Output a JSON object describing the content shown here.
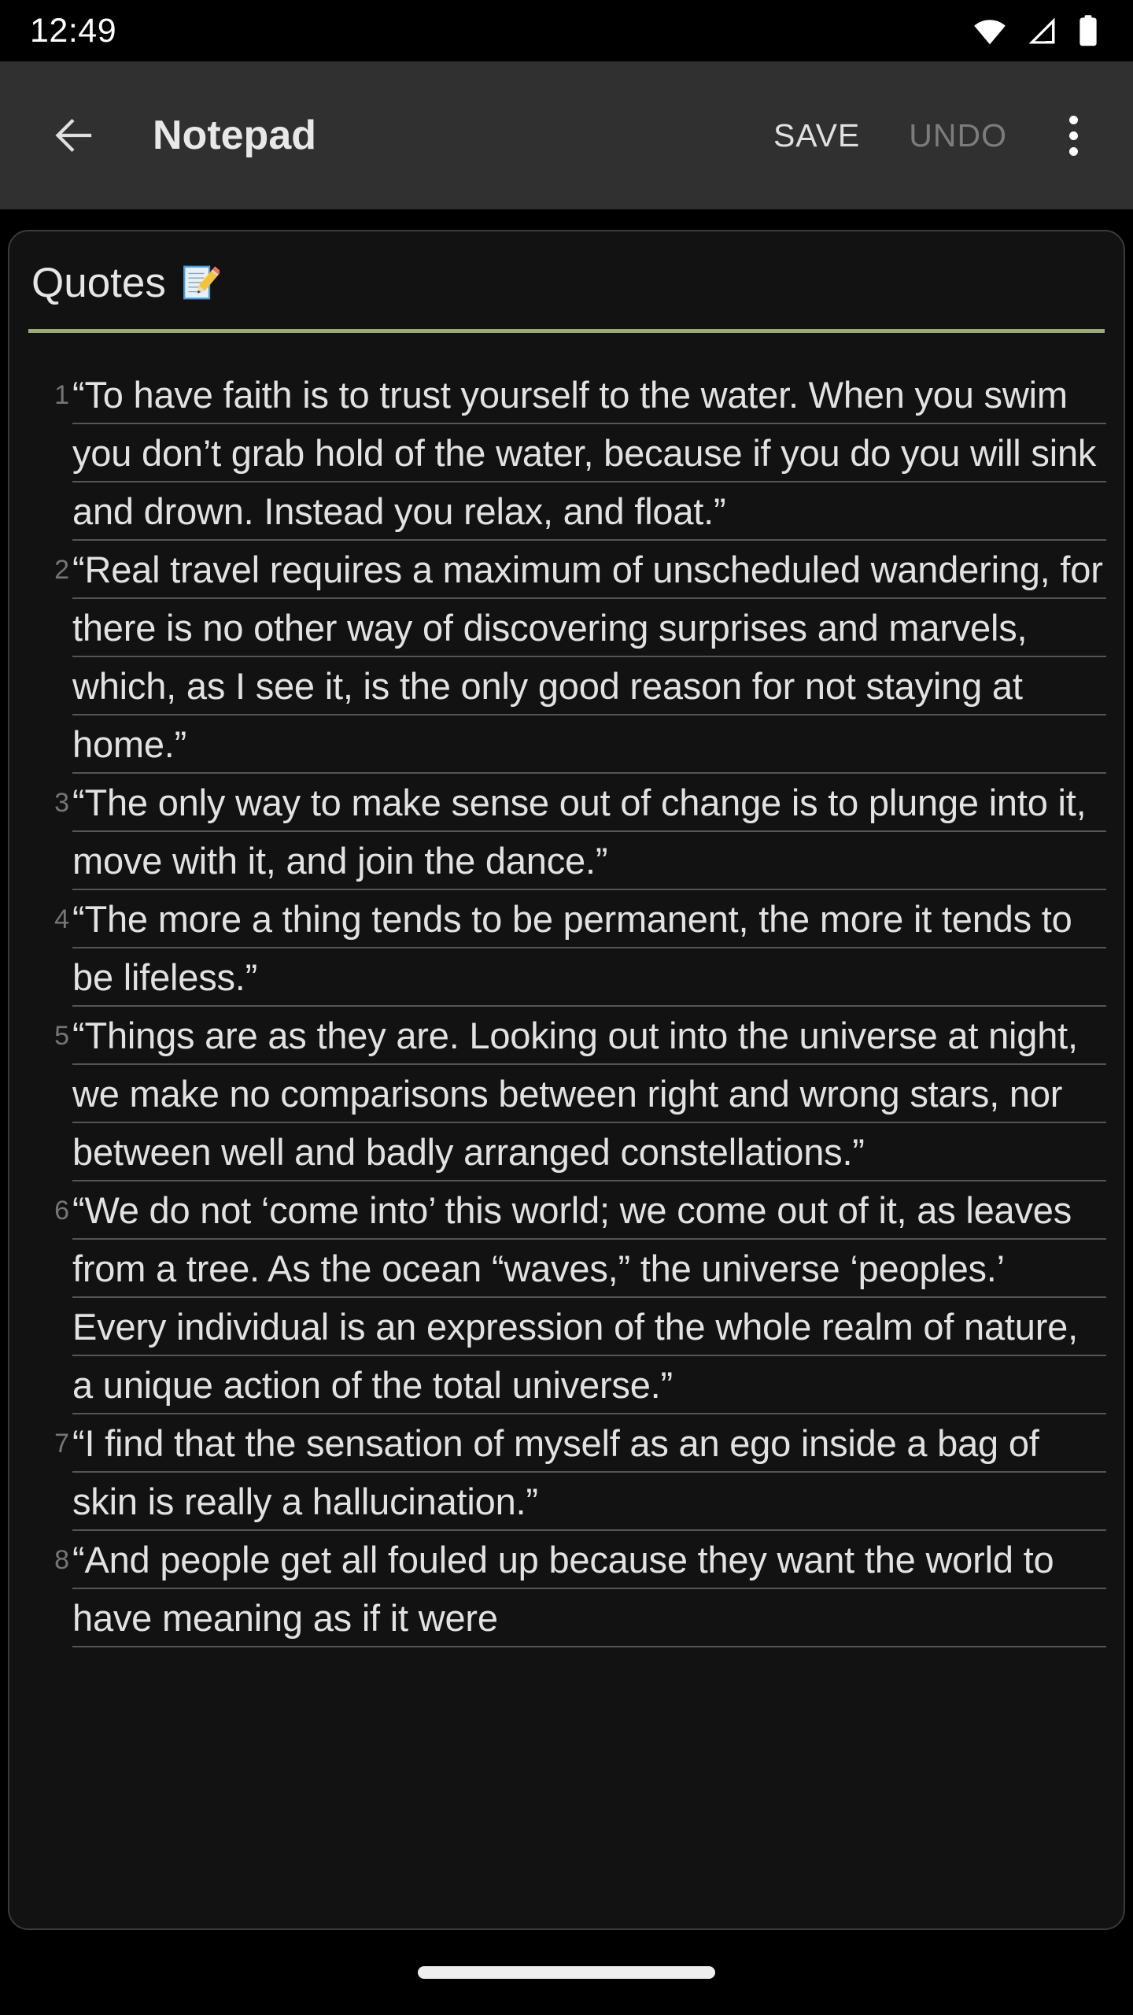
{
  "status_bar": {
    "clock": "12:49",
    "icons": [
      {
        "name": "wifi-icon",
        "label": "wifi-full"
      },
      {
        "name": "cellular-signal-icon",
        "label": "cellular-signal"
      },
      {
        "name": "battery-icon",
        "label": "battery-full"
      }
    ]
  },
  "app_bar": {
    "back_label": "back-arrow",
    "title": "Notepad",
    "save_label": "SAVE",
    "undo_label": "UNDO",
    "undo_enabled": false,
    "overflow_label": "more-options"
  },
  "note": {
    "title": "Quotes",
    "title_emoji": "memo",
    "underline_color": "#9aab7b",
    "quotes": [
      {
        "number": "1",
        "text": "“To have faith is to trust yourself to the water. When you swim you don’t grab hold of the water, because if you do you will sink and drown. Instead you relax, and float.”"
      },
      {
        "number": "2",
        "text": "“Real travel requires a maximum of unscheduled wandering, for there is no other way of discovering surprises and marvels, which, as I see it, is the only good reason for not staying at home.”"
      },
      {
        "number": "3",
        "text": "“The only way to make sense out of change is to plunge into it, move with it, and join the dance.”"
      },
      {
        "number": "4",
        "text": "“The more a thing tends to be permanent, the more it tends to be lifeless.”"
      },
      {
        "number": "5",
        "text": "“Things are as they are. Looking out into the universe at night, we make no comparisons between right and wrong stars, nor between well and badly arranged constellations.”"
      },
      {
        "number": "6",
        "text": "“We do not ‘come into’ this world; we come out of it, as leaves from a tree. As the ocean “waves,” the universe ‘peoples.’ Every individual is an expression of the whole realm of nature, a unique action of the total universe.”"
      },
      {
        "number": "7",
        "text": "“I find that the sensation of myself as an ego inside a bag of skin is really a hallucination.”"
      },
      {
        "number": "8",
        "text": "“And people get all fouled up because they want the world to have meaning as if it were"
      }
    ]
  },
  "nav_bar": {
    "home_pill_label": "home-gesture-pill"
  },
  "colors": {
    "window_background": "#000000",
    "app_bar_background": "#303030",
    "card_background": "#121212",
    "card_border": "#3a3a3a",
    "text_primary": "#e2e2e2",
    "line_number": "#757575",
    "rule_line": "#555555",
    "accent_underline": "#9aab7b",
    "disabled_action": "#7c7c7c"
  }
}
